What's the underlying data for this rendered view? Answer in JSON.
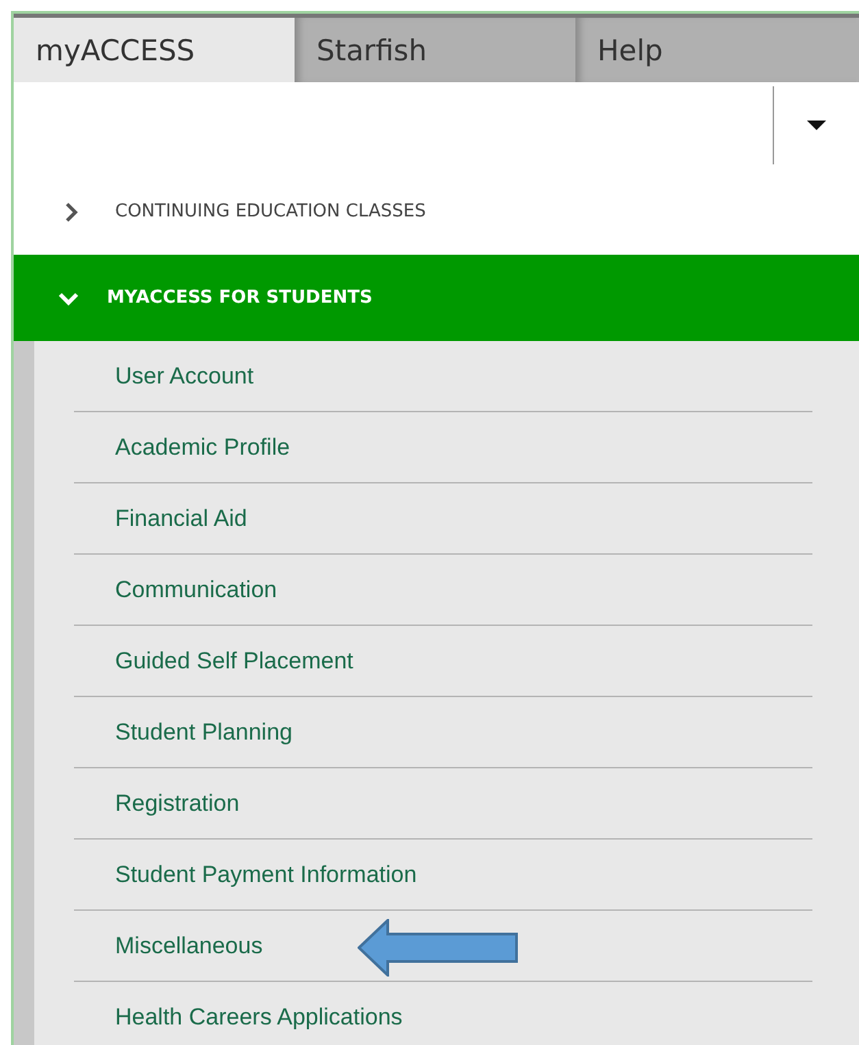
{
  "tabs": [
    {
      "label": "myACCESS",
      "selected": true
    },
    {
      "label": "Starfish",
      "selected": false
    },
    {
      "label": "Help",
      "selected": false
    }
  ],
  "sections": [
    {
      "title": "CONTINUING EDUCATION CLASSES",
      "expanded": false
    },
    {
      "title": "MYACCESS FOR STUDENTS",
      "expanded": true,
      "items": [
        {
          "label": "User Account",
          "arrow": false
        },
        {
          "label": "Academic Profile",
          "arrow": false
        },
        {
          "label": "Financial Aid",
          "arrow": false
        },
        {
          "label": "Communication",
          "arrow": false
        },
        {
          "label": "Guided Self Placement",
          "arrow": false
        },
        {
          "label": "Student Planning",
          "arrow": false
        },
        {
          "label": "Registration",
          "arrow": false
        },
        {
          "label": "Student Payment Information",
          "arrow": false
        },
        {
          "label": "Miscellaneous",
          "arrow": true
        },
        {
          "label": "Health Careers Applications",
          "arrow": false
        }
      ]
    }
  ]
}
